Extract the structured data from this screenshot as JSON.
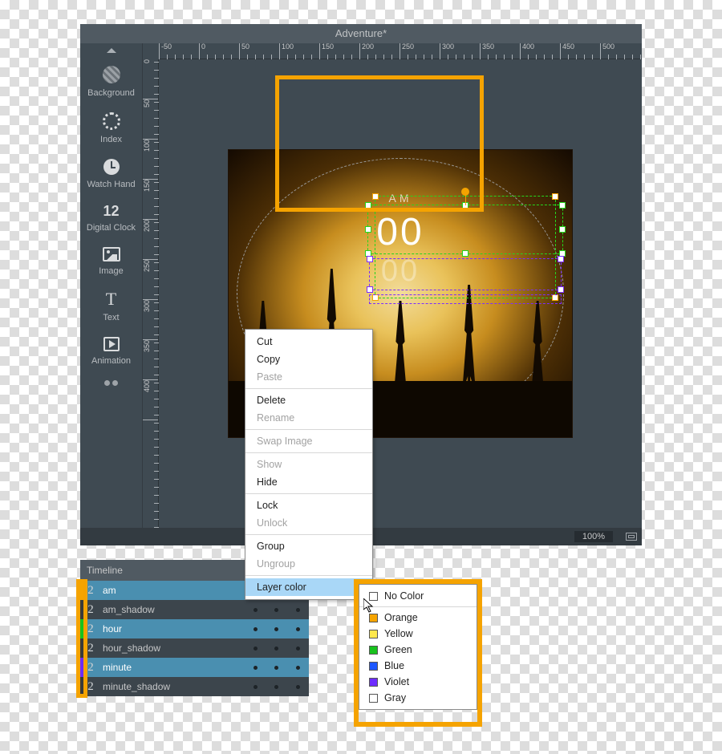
{
  "project_title": "Adventure*",
  "toolbar": [
    {
      "label": "Background"
    },
    {
      "label": "Index"
    },
    {
      "label": "Watch Hand"
    },
    {
      "label": "Digital Clock"
    },
    {
      "label": "Image"
    },
    {
      "label": "Text"
    },
    {
      "label": "Animation"
    }
  ],
  "ruler_h": [
    "-50",
    "0",
    "50",
    "100",
    "150",
    "200",
    "250",
    "300",
    "350",
    "400",
    "450",
    "500"
  ],
  "ruler_v": [
    "0",
    "50",
    "100",
    "150",
    "200",
    "250",
    "300",
    "350",
    "400"
  ],
  "canvas": {
    "ampm": "AM",
    "hours": "00",
    "minutes": "00"
  },
  "status": {
    "zoom": "100%"
  },
  "timeline": {
    "title": "Timeline",
    "rows": [
      {
        "idx": "2",
        "name": "am",
        "color": "#f6a400",
        "sel": true
      },
      {
        "idx": "2",
        "name": "am_shadow",
        "color": "#3a3a3a",
        "sel": false
      },
      {
        "idx": "2",
        "name": "hour",
        "color": "#18c21d",
        "sel": true
      },
      {
        "idx": "2",
        "name": "hour_shadow",
        "color": "#3a3a3a",
        "sel": false
      },
      {
        "idx": "2",
        "name": "minute",
        "color": "#6d2cff",
        "sel": true
      },
      {
        "idx": "2",
        "name": "minute_shadow",
        "color": "#3a3a3a",
        "sel": false
      }
    ]
  },
  "context_menu": {
    "groups": [
      [
        {
          "t": "Cut"
        },
        {
          "t": "Copy"
        },
        {
          "t": "Paste",
          "dis": true
        }
      ],
      [
        {
          "t": "Delete"
        },
        {
          "t": "Rename",
          "dis": true
        }
      ],
      [
        {
          "t": "Swap Image",
          "dis": true
        }
      ],
      [
        {
          "t": "Show",
          "dis": true
        },
        {
          "t": "Hide"
        }
      ],
      [
        {
          "t": "Lock"
        },
        {
          "t": "Unlock",
          "dis": true
        }
      ],
      [
        {
          "t": "Group"
        },
        {
          "t": "Ungroup",
          "dis": true
        }
      ]
    ],
    "hover_item": "Layer color"
  },
  "submenu": {
    "no_color": "No Color",
    "items": [
      {
        "t": "Orange",
        "c": "#f6a400"
      },
      {
        "t": "Yellow",
        "c": "#ffe84d"
      },
      {
        "t": "Green",
        "c": "#18c21d"
      },
      {
        "t": "Blue",
        "c": "#1d57ff"
      },
      {
        "t": "Violet",
        "c": "#6d2cff"
      },
      {
        "t": "Gray",
        "c": "#ffffff"
      }
    ]
  }
}
